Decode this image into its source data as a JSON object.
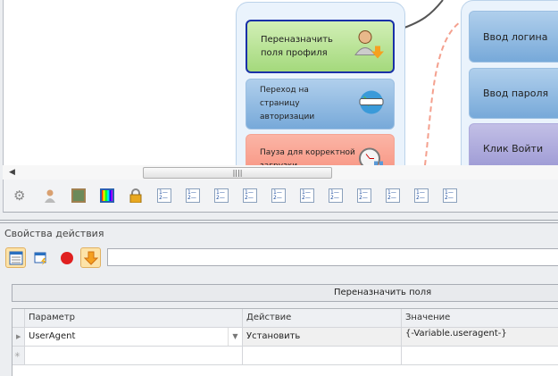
{
  "canvas": {
    "left_group": [
      {
        "label": "Переназначить поля профиля",
        "color": "green",
        "icon": "user-down-icon"
      },
      {
        "label": "Переход на страницу авторизации",
        "color": "blue",
        "icon": "www-globe-icon"
      },
      {
        "label": "Пауза для корректной загрузки",
        "color": "red",
        "icon": "stopwatch-pause-icon"
      }
    ],
    "right_group": [
      {
        "label": "Ввод логина",
        "color": "blue"
      },
      {
        "label": "Ввод пароля",
        "color": "blue"
      },
      {
        "label": "Клик Войти",
        "color": "purple"
      }
    ],
    "scroll_grip": "||||"
  },
  "toolbar": {
    "icons": [
      "gear-icon",
      "user-icon",
      "chalkboard-icon",
      "palette-icon",
      "lock-icon",
      "numbered-list-icon",
      "numbered-list-icon",
      "numbered-list-icon",
      "numbered-list-icon",
      "numbered-list-icon",
      "numbered-list-icon",
      "numbered-list-icon",
      "numbered-list-icon",
      "numbered-list-icon",
      "numbered-list-icon",
      "numbered-list-icon"
    ],
    "list_glyph": "1—2—"
  },
  "properties": {
    "title": "Свойства действия",
    "input_value": "",
    "grid_title": "Переназначить поля",
    "columns": [
      "Параметр",
      "Действие",
      "Значение"
    ],
    "rows": [
      {
        "param": "UserAgent",
        "action": "Установить",
        "value": "{-Variable.useragent-}"
      }
    ],
    "new_row_marker": "✳"
  },
  "colors": {
    "green": "#a4d97c",
    "blue": "#77a9d9",
    "red": "#f78c78",
    "purple": "#9a97d3",
    "accent": "#fde3a8"
  }
}
